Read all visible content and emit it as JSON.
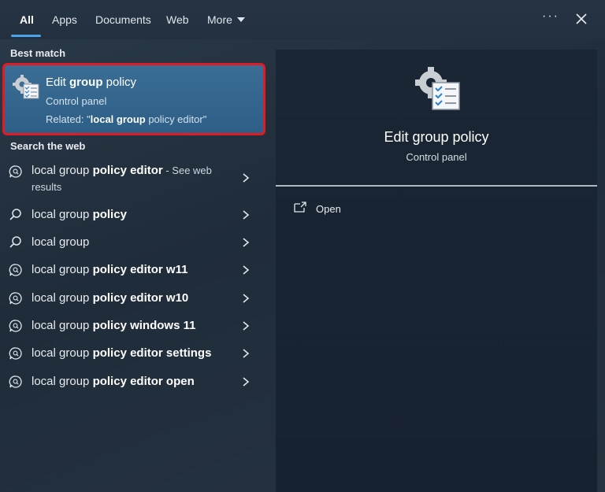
{
  "tabs": [
    {
      "label": "All"
    },
    {
      "label": "Apps"
    },
    {
      "label": "Documents"
    },
    {
      "label": "Web"
    },
    {
      "label": "More"
    }
  ],
  "sections": {
    "best_match": "Best match",
    "search_web": "Search the web"
  },
  "best_match": {
    "title_pre": "Edit ",
    "title_bold": "group",
    "title_post": " policy",
    "subtitle": "Control panel",
    "related_pre": "Related: \"",
    "related_bold": "local group",
    "related_post": " policy editor\""
  },
  "web_results": [
    {
      "plain": "local group ",
      "bold": "policy editor",
      "suffix": " - See web results",
      "icon": "chat-search-icon"
    },
    {
      "plain": "local group ",
      "bold": "policy",
      "suffix": "",
      "icon": "search-icon"
    },
    {
      "plain": "local group",
      "bold": "",
      "suffix": "",
      "icon": "search-icon"
    },
    {
      "plain": "local group ",
      "bold": "policy editor w11",
      "suffix": "",
      "icon": "chat-search-icon"
    },
    {
      "plain": "local group ",
      "bold": "policy editor w10",
      "suffix": "",
      "icon": "chat-search-icon"
    },
    {
      "plain": "local group ",
      "bold": "policy windows 11",
      "suffix": "",
      "icon": "chat-search-icon"
    },
    {
      "plain": "local group ",
      "bold": "policy editor settings",
      "suffix": "",
      "icon": "chat-search-icon"
    },
    {
      "plain": "local group ",
      "bold": "policy editor open",
      "suffix": "",
      "icon": "chat-search-icon"
    }
  ],
  "preview": {
    "title": "Edit group policy",
    "subtitle": "Control panel",
    "actions": [
      {
        "label": "Open",
        "icon": "open-external-icon"
      }
    ]
  },
  "colors": {
    "accent": "#4aa3e8",
    "highlight_border": "#e01b24",
    "selected_bg": "#2e5f86"
  }
}
